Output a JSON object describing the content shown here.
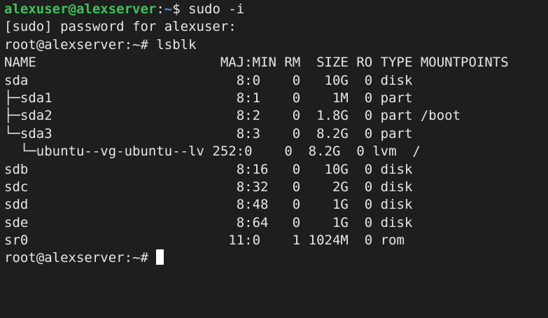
{
  "prompt_user": {
    "user_host": "alexuser@alexserver",
    "separator": ":",
    "cwd": "~",
    "symbol": "$ ",
    "command": "sudo -i"
  },
  "sudo_prompt": "[sudo] password for alexuser:",
  "root_prompt": {
    "text": "root@alexserver:~# ",
    "command": "lsblk"
  },
  "lsblk": {
    "header": "NAME                       MAJ:MIN RM  SIZE RO TYPE MOUNTPOINTS",
    "rows": [
      "sda                          8:0    0   10G  0 disk",
      "├─sda1                       8:1    0    1M  0 part",
      "├─sda2                       8:2    0  1.8G  0 part /boot",
      "└─sda3                       8:3    0  8.2G  0 part",
      "  └─ubuntu--vg-ubuntu--lv 252:0    0  8.2G  0 lvm  /",
      "sdb                          8:16   0   10G  0 disk",
      "sdc                          8:32   0    2G  0 disk",
      "sdd                          8:48   0    1G  0 disk",
      "sde                          8:64   0    1G  0 disk",
      "sr0                         11:0    1 1024M  0 rom"
    ]
  },
  "final_prompt": "root@alexserver:~# "
}
